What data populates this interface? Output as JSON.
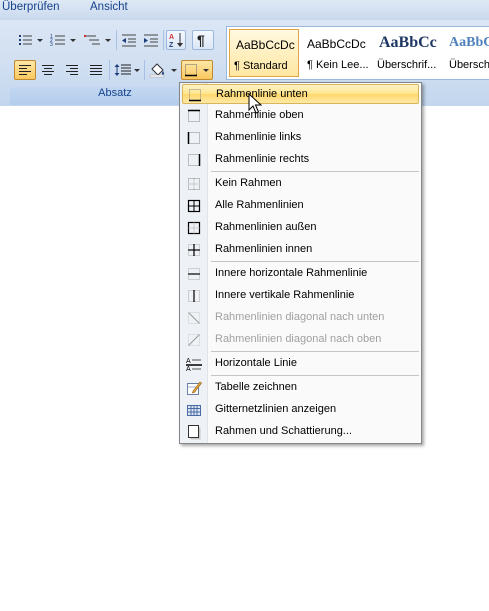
{
  "ribbon_tabs": [
    "Überprüfen",
    "Ansicht"
  ],
  "ribbon": {
    "group_label": "Absatz",
    "styles": [
      {
        "sample": "AaBbCcDc",
        "name": "¶ Standard",
        "selected": true
      },
      {
        "sample": "AaBbCcDc",
        "name": "¶ Kein Lee...",
        "selected": false
      },
      {
        "sample": "AaBbCc",
        "name": "Überschrif...",
        "selected": false
      },
      {
        "sample": "AaBbC",
        "name": "Überschri",
        "selected": false
      }
    ]
  },
  "border_menu": {
    "items": [
      {
        "label": "Rahmenlinie unten",
        "icon": "border-bottom-icon",
        "highlighted": true,
        "disabled": false
      },
      {
        "label": "Rahmenlinie oben",
        "icon": "border-top-icon",
        "disabled": false
      },
      {
        "label": "Rahmenlinie links",
        "icon": "border-left-icon",
        "disabled": false
      },
      {
        "label": "Rahmenlinie rechts",
        "icon": "border-right-icon",
        "disabled": false
      },
      {
        "label": "Kein Rahmen",
        "icon": "no-border-icon",
        "disabled": false
      },
      {
        "label": "Alle Rahmenlinien",
        "icon": "all-borders-icon",
        "disabled": false
      },
      {
        "label": "Rahmenlinien außen",
        "icon": "outside-borders-icon",
        "disabled": false
      },
      {
        "label": "Rahmenlinien innen",
        "icon": "inside-borders-icon",
        "disabled": false
      },
      {
        "label": "Innere horizontale Rahmenlinie",
        "icon": "inside-horizontal-border-icon",
        "disabled": false
      },
      {
        "label": "Innere vertikale Rahmenlinie",
        "icon": "inside-vertical-border-icon",
        "disabled": false
      },
      {
        "label": "Rahmenlinien diagonal nach unten",
        "icon": "diagonal-down-border-icon",
        "disabled": true
      },
      {
        "label": "Rahmenlinien diagonal nach oben",
        "icon": "diagonal-up-border-icon",
        "disabled": true
      },
      {
        "label": "Horizontale Linie",
        "icon": "horizontal-line-icon",
        "disabled": false
      },
      {
        "label": "Tabelle zeichnen",
        "icon": "draw-table-icon",
        "disabled": false
      },
      {
        "label": "Gitternetzlinien anzeigen",
        "icon": "gridlines-icon",
        "disabled": false
      },
      {
        "label": "Rahmen und Schattierung...",
        "icon": "borders-shading-icon",
        "disabled": false
      }
    ]
  },
  "colors": {
    "accent": "#15428b",
    "highlight": "#ffe58f",
    "disabled_text": "#a0a0a0"
  }
}
